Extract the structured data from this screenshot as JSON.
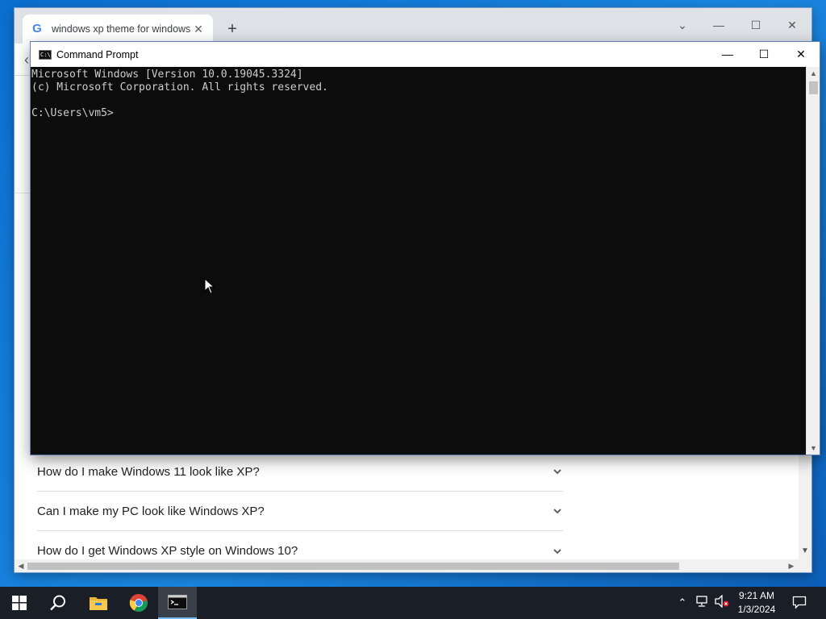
{
  "browser": {
    "tab_title": "windows xp theme for windows",
    "tab_close": "✕",
    "new_tab": "+",
    "controls": {
      "dropdown": "⌄",
      "minimize": "—",
      "maximize": "☐",
      "close": "✕"
    },
    "faq": [
      {
        "question": "How do I make Windows 11 look like XP?"
      },
      {
        "question": "Can I make my PC look like Windows XP?"
      },
      {
        "question": "How do I get Windows XP style on Windows 10?"
      }
    ]
  },
  "cmd": {
    "title": "Command Prompt",
    "icon_text": "C:\\",
    "lines": [
      "Microsoft Windows [Version 10.0.19045.3324]",
      "(c) Microsoft Corporation. All rights reserved.",
      "",
      "C:\\Users\\vm5>"
    ],
    "controls": {
      "minimize": "—",
      "maximize": "☐",
      "close": "✕"
    }
  },
  "taskbar": {
    "time": "9:21 AM",
    "date": "1/3/2024",
    "tray": {
      "chevron": "⌃",
      "notifications": "🗨"
    }
  },
  "colors": {
    "desktop": "#0b6fd0",
    "taskbar": "#1a1f27",
    "console_bg": "#0c0c0c",
    "console_fg": "#cccccc"
  }
}
